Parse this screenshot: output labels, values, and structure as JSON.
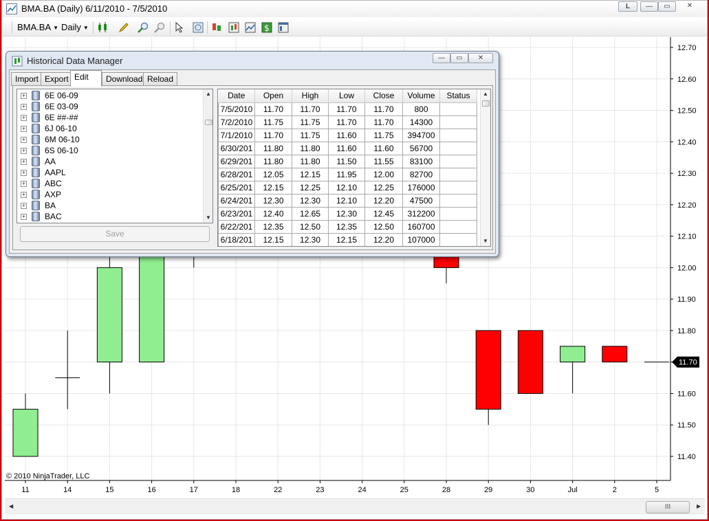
{
  "window": {
    "title": "BMA.BA (Daily)  6/11/2010 - 7/5/2010",
    "caption_buttons": [
      "L",
      "—",
      "▭",
      "✕"
    ]
  },
  "toolbar": {
    "instrument": "BMA.BA",
    "interval": "Daily"
  },
  "chart": {
    "copyright": "© 2010 NinjaTrader, LLC",
    "last_price_label": "11.70",
    "y_ticks": [
      "12.70",
      "12.60",
      "12.50",
      "12.40",
      "12.30",
      "12.20",
      "12.10",
      "12.00",
      "11.90",
      "11.80",
      "11.70",
      "11.60",
      "11.50",
      "11.40"
    ],
    "x_ticks": [
      "11",
      "14",
      "15",
      "16",
      "17",
      "18",
      "22",
      "23",
      "24",
      "25",
      "28",
      "29",
      "30",
      "Jul",
      "2",
      "5"
    ],
    "colors": {
      "up": "#90ee90",
      "down": "#ff0000",
      "grid": "#e6e6e6",
      "outline": "#000000"
    }
  },
  "chart_data": {
    "type": "candlestick",
    "title": "BMA.BA (Daily)  6/11/2010 - 7/5/2010",
    "ylim": [
      11.35,
      12.75
    ],
    "candles": [
      {
        "x": "11",
        "open": 11.4,
        "high": 11.6,
        "low": 11.4,
        "close": 11.55
      },
      {
        "x": "14",
        "open": 11.65,
        "high": 11.8,
        "low": 11.55,
        "close": 11.65
      },
      {
        "x": "15",
        "open": 11.7,
        "high": 12.05,
        "low": 11.6,
        "close": 12.0
      },
      {
        "x": "16",
        "open": 11.7,
        "high": 12.05,
        "low": 11.7,
        "close": 12.05
      },
      {
        "x": "17",
        "open": 12.05,
        "high": 12.05,
        "low": 12.0,
        "close": 12.05
      },
      {
        "x": "28",
        "open": 12.05,
        "high": 12.15,
        "low": 11.95,
        "close": 12.0
      },
      {
        "x": "29",
        "open": 11.8,
        "high": 11.8,
        "low": 11.5,
        "close": 11.55
      },
      {
        "x": "30",
        "open": 11.8,
        "high": 11.8,
        "low": 11.6,
        "close": 11.6
      },
      {
        "x": "Jul",
        "open": 11.7,
        "high": 11.75,
        "low": 11.6,
        "close": 11.75
      },
      {
        "x": "2",
        "open": 11.75,
        "high": 11.75,
        "low": 11.7,
        "close": 11.7
      },
      {
        "x": "5",
        "open": 11.7,
        "high": 11.7,
        "low": 11.7,
        "close": 11.7
      }
    ]
  },
  "hdm": {
    "title": "Historical Data Manager",
    "tabs": [
      "Import",
      "Export",
      "Edit",
      "Download",
      "Reload"
    ],
    "active_tab": "Edit",
    "tree_items": [
      "6E 06-09",
      "6E 03-09",
      "6E ##-##",
      "6J 06-10",
      "6M 06-10",
      "6S 06-10",
      "AA",
      "AAPL",
      "ABC",
      "AXP",
      "BA",
      "BAC"
    ],
    "save_label": "Save",
    "columns": [
      "Date",
      "Open",
      "High",
      "Low",
      "Close",
      "Volume",
      "Status"
    ],
    "rows": [
      [
        "7/5/2010",
        "11.70",
        "11.70",
        "11.70",
        "11.70",
        "800",
        ""
      ],
      [
        "7/2/2010",
        "11.75",
        "11.75",
        "11.70",
        "11.70",
        "14300",
        ""
      ],
      [
        "7/1/2010",
        "11.70",
        "11.75",
        "11.60",
        "11.75",
        "394700",
        ""
      ],
      [
        "6/30/201",
        "11.80",
        "11.80",
        "11.60",
        "11.60",
        "56700",
        ""
      ],
      [
        "6/29/201",
        "11.80",
        "11.80",
        "11.50",
        "11.55",
        "83100",
        ""
      ],
      [
        "6/28/201",
        "12.05",
        "12.15",
        "11.95",
        "12.00",
        "82700",
        ""
      ],
      [
        "6/25/201",
        "12.15",
        "12.25",
        "12.10",
        "12.25",
        "176000",
        ""
      ],
      [
        "6/24/201",
        "12.30",
        "12.30",
        "12.10",
        "12.20",
        "47500",
        ""
      ],
      [
        "6/23/201",
        "12.40",
        "12.65",
        "12.30",
        "12.45",
        "312200",
        ""
      ],
      [
        "6/22/201",
        "12.35",
        "12.50",
        "12.35",
        "12.50",
        "160700",
        ""
      ],
      [
        "6/18/201",
        "12.15",
        "12.30",
        "12.15",
        "12.20",
        "107000",
        ""
      ]
    ]
  },
  "scrollbar": {
    "thumb_glyph": "III"
  }
}
